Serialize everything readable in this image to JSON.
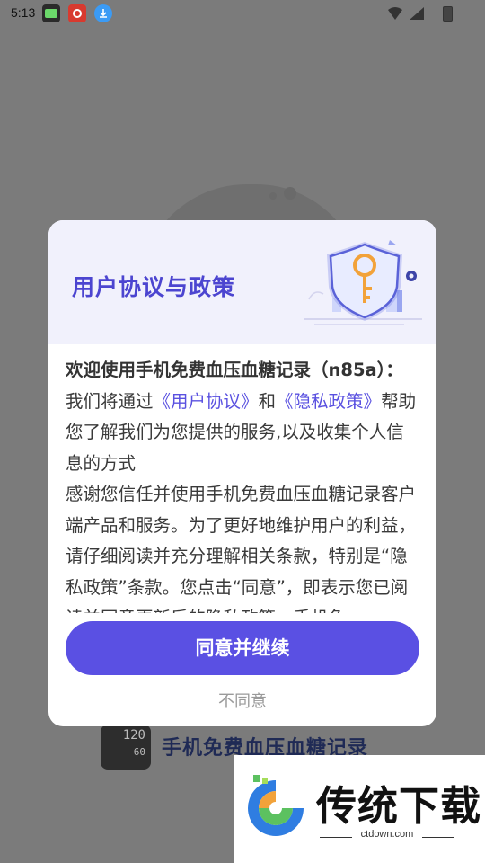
{
  "status_bar": {
    "time": "5:13"
  },
  "background_app": {
    "device_reading": "120",
    "device_reading_small": "60",
    "app_title": "手机免费血压血糖记录"
  },
  "dialog": {
    "title": "用户协议与政策",
    "greeting": "欢迎使用手机免费血压血糖记录（n85a）：",
    "intro_prefix": "我们将通过",
    "user_agreement_link": "《用户协议》",
    "and": "和",
    "privacy_policy_link": "《隐私政策》",
    "intro_suffix": "帮助您了解我们为您提供的服务,以及收集个人信息的方式",
    "para2": "感谢您信任并使用手机免费血压血糖记录客户端产品和服务。为了更好地维护用户的利益，请仔细阅读并充分理解相关条款，特别是“隐私政策”条款。您点击“同意”，即表示您已阅读并同意更新后的隐私政策，手机免",
    "agree_button": "同意并继续",
    "disagree_button": "不同意"
  },
  "watermark": {
    "brand": "传统下载",
    "url": "ctdown.com"
  },
  "colors": {
    "accent": "#5a50e3",
    "title": "#4c45d0",
    "overlay": "#7b7b7b"
  }
}
